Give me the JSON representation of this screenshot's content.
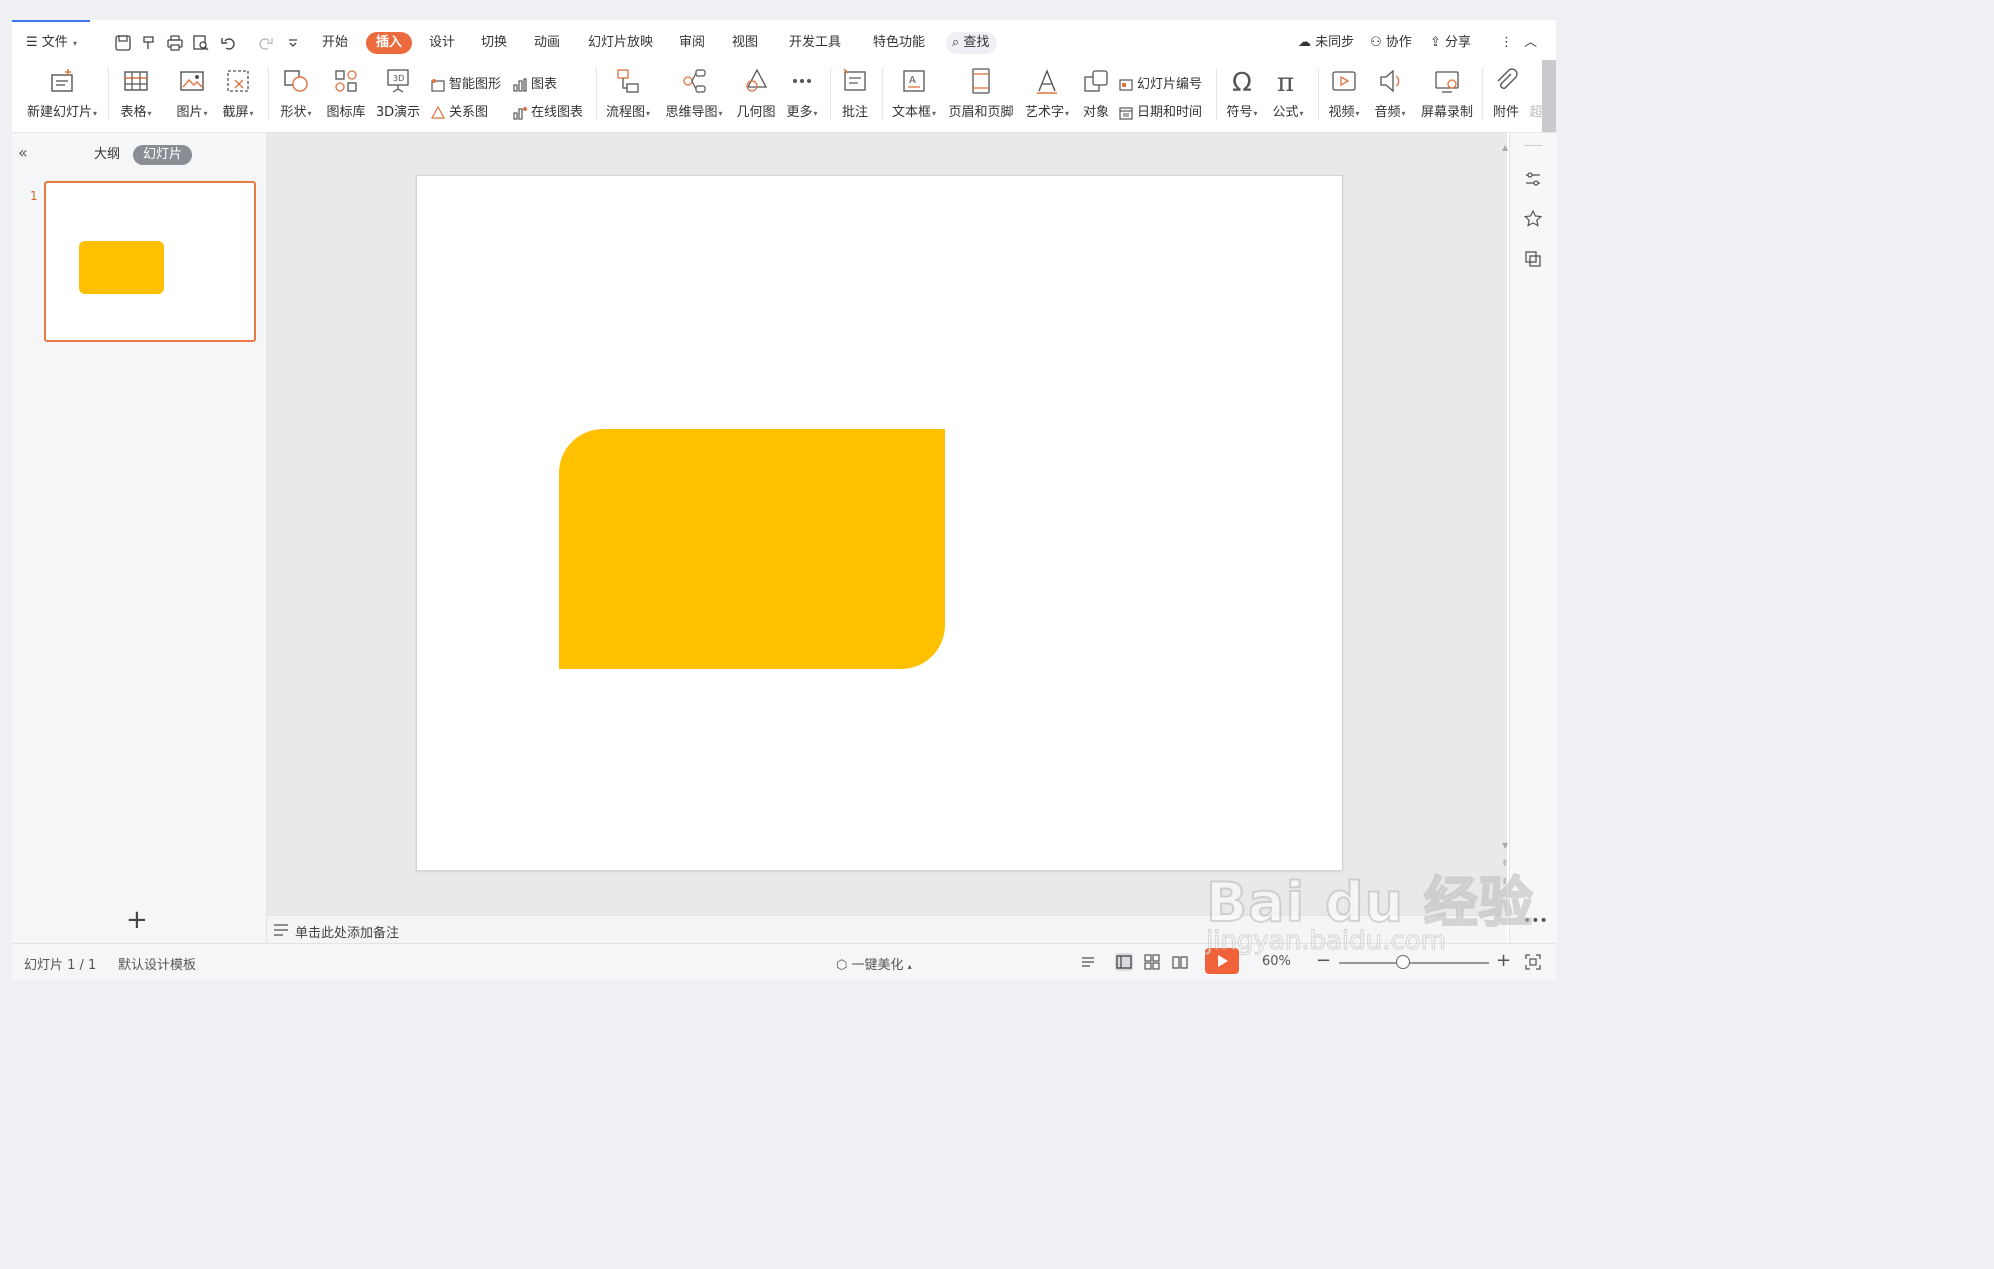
{
  "colors": {
    "accent": "#ec6b3e",
    "shape_fill": "#ffc000",
    "thumb_border": "#e97a44"
  },
  "menubar": {
    "file_label": "文件",
    "tabs": [
      "开始",
      "插入",
      "设计",
      "切换",
      "动画",
      "幻灯片放映",
      "审阅",
      "视图",
      "开发工具",
      "特色功能"
    ],
    "active_tab": "插入",
    "search_label": "查找",
    "sync_label": "未同步",
    "collab_label": "协作",
    "share_label": "分享"
  },
  "ribbon": {
    "new_slide": "新建幻灯片",
    "table": "表格",
    "picture": "图片",
    "screenshot": "截屏",
    "shape": "形状",
    "icon_lib": "图标库",
    "demo3d": "3D演示",
    "smart_art": "智能图形",
    "chart": "图表",
    "relation": "关系图",
    "online_chart": "在线图表",
    "flowchart": "流程图",
    "mindmap": "思维导图",
    "geometry": "几何图",
    "more": "更多",
    "comment": "批注",
    "textbox": "文本框",
    "header_footer": "页眉和页脚",
    "wordart": "艺术字",
    "object": "对象",
    "slide_number": "幻灯片编号",
    "datetime": "日期和时间",
    "symbol": "符号",
    "formula": "公式",
    "video": "视频",
    "audio": "音频",
    "screen_record": "屏幕录制",
    "attachment": "附件",
    "hyperlink_partial": "超"
  },
  "left_panel": {
    "tab_outline": "大纲",
    "tab_slides": "幻灯片",
    "slide_number": "1"
  },
  "notes": {
    "placeholder": "单击此处添加备注"
  },
  "status": {
    "slide_info": "幻灯片 1 / 1",
    "template": "默认设计模板",
    "beautify": "一键美化",
    "zoom": "60%"
  },
  "watermark": {
    "brand": "Bai du 经验",
    "url": "jingyan.baidu.com"
  }
}
